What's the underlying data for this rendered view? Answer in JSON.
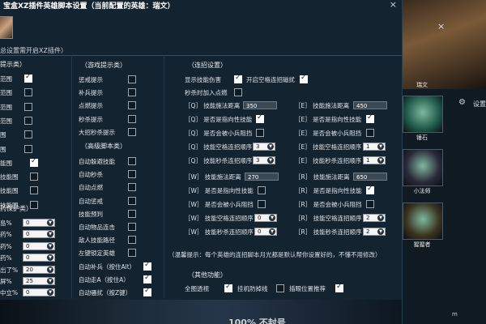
{
  "window": {
    "title": "宝盒XZ插件英雄脚本设置（当前配置的英雄：瑞文）",
    "close": "×",
    "subtitle": "总设置需开启XZ插件）"
  },
  "col1": {
    "header": "提示类）",
    "rows": [
      {
        "label": "范围",
        "checked": true
      },
      {
        "label": "范围",
        "checked": false
      },
      {
        "label": "范围",
        "checked": false
      },
      {
        "label": "范围",
        "checked": false
      },
      {
        "label": "围",
        "checked": false
      },
      {
        "label": "围",
        "checked": false
      },
      {
        "label": "能围",
        "checked": true
      },
      {
        "label": "技能围",
        "checked": false
      },
      {
        "label": "技能围",
        "checked": false
      },
      {
        "label": "技能围",
        "checked": false
      }
    ],
    "header2": "药保护类）",
    "spins": [
      {
        "label": "島%",
        "value": "0"
      },
      {
        "label": "药%",
        "value": "0"
      },
      {
        "label": "药%",
        "value": "0"
      },
      {
        "label": "药%",
        "value": "0"
      },
      {
        "label": "出了%",
        "value": "20"
      },
      {
        "label": "屏%",
        "value": "25"
      },
      {
        "label": "中立%",
        "value": "0"
      }
    ]
  },
  "col2": {
    "header": "（游戏提示类）",
    "rows": [
      {
        "label": "惩戒提示",
        "checked": false
      },
      {
        "label": "补兵提示",
        "checked": false
      },
      {
        "label": "点燃提示",
        "checked": false
      },
      {
        "label": "秒杀提示",
        "checked": false
      },
      {
        "label": "大招秒杀提示",
        "checked": false
      }
    ],
    "header2": "（高级脚本类）",
    "rows2": [
      {
        "label": "自动躲避技能",
        "checked": false
      },
      {
        "label": "自动秒杀",
        "checked": false
      },
      {
        "label": "自动点燃",
        "checked": false
      },
      {
        "label": "自动惩戒",
        "checked": false
      },
      {
        "label": "技能预判",
        "checked": false
      },
      {
        "label": "自动物品连击",
        "checked": false
      },
      {
        "label": "敌人技能路径",
        "checked": false
      },
      {
        "label": "左键锁定英雄",
        "checked": false
      },
      {
        "label": "自动补兵（按住Alt）",
        "checked": true
      },
      {
        "label": "自动走A（按住A）",
        "checked": true
      },
      {
        "label": "自动骚扰（按Z键）",
        "checked": true
      }
    ]
  },
  "col3": {
    "header": "（连招设置）",
    "show_range": {
      "label": "显示技能伤害",
      "checked": true
    },
    "space_combo": {
      "label": "开启空格连招磁扰",
      "checked": true
    },
    "flash": {
      "label": "秒杀时加入点燃",
      "checked": false
    },
    "q": {
      "dist_label": "［Q］ 技能施法距离",
      "dist_value": "350",
      "dir_label": "［Q］ 是否是指向性技能",
      "dir_checked": true,
      "block_label": "［Q］ 是否会被小兵阻挡",
      "block_checked": false,
      "space_label": "［Q］ 技能空格连招顺序",
      "space_value": "3",
      "kill_label": "［Q］ 技能秒杀连招顺序",
      "kill_value": "3"
    },
    "w": {
      "dist_label": "［W］ 技能施法距离",
      "dist_value": "270",
      "dir_label": "［W］ 是否是指向性技能",
      "dir_checked": false,
      "block_label": "［W］ 是否会被小兵阻挡",
      "block_checked": false,
      "space_label": "［W］ 技能空格连招顺序",
      "space_value": "0",
      "kill_label": "［W］ 技能秒杀连招顺序",
      "kill_value": "0"
    },
    "e": {
      "dist_label": "［E］ 技能施法距离",
      "dist_value": "450",
      "dir_label": "［E］ 是否是指向性技能",
      "dir_checked": true,
      "block_label": "［E］ 是否会被小兵阻挡",
      "block_checked": false,
      "space_label": "［E］ 技能空格连招顺序",
      "space_value": "1",
      "kill_label": "［E］ 技能秒杀连招顺序",
      "kill_value": "1"
    },
    "r": {
      "dist_label": "［R］ 技能施法距离",
      "dist_value": "650",
      "dir_label": "［R］ 是否是指向性技能",
      "dir_checked": true,
      "block_label": "［R］ 是否会被小兵阻挡",
      "block_checked": false,
      "space_label": "［R］ 技能空格连招顺序",
      "space_value": "2",
      "kill_label": "［R］ 技能秒杀连招顺序",
      "kill_value": "2"
    }
  },
  "hint": "（温馨提示：每个英雄的连招脚本月光都是默认帮你设置好的，不懂不用修改）",
  "other": {
    "header": "（其他功能）",
    "items": [
      {
        "label": "全图透视",
        "checked": true
      },
      {
        "label": "挂机防掉线",
        "checked": false
      },
      {
        "label": "插眼位置推荐",
        "checked": true
      }
    ]
  },
  "banner": {
    "text": "100% 不封号"
  },
  "right_panel": {
    "close": "×",
    "settings_label": "设置",
    "champions": [
      {
        "name": "瑞文"
      },
      {
        "name": "锤石"
      },
      {
        "name": "小法师"
      },
      {
        "name": "猩猩者"
      }
    ],
    "watermark": "m"
  }
}
